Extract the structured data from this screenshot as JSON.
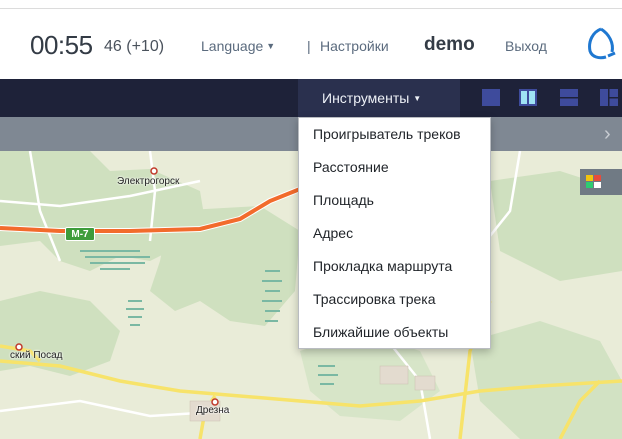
{
  "header": {
    "clock_main": "00:55",
    "clock_sub": "46 (+10)",
    "language_label": "Language",
    "separator": "|",
    "settings_label": "Настройки",
    "user_name": "demo",
    "logout_label": "Выход"
  },
  "navbar": {
    "tools_label": "Инструменты"
  },
  "tools_menu": {
    "items": [
      "Проигрыватель треков",
      "Расстояние",
      "Площадь",
      "Адрес",
      "Прокладка маршрута",
      "Трассировка трека",
      "Ближайшие объекты"
    ]
  },
  "map": {
    "labels": [
      "Электрогорск",
      "ский Посад",
      "Дрезна"
    ],
    "road_badge": "M-7"
  },
  "colors": {
    "navbar": "#1e2239",
    "subbar": "#7f8893",
    "layout_icon": "#3e4b9c",
    "highway": "#f26b2c",
    "road_badge": "#3e9c3b",
    "logo": "#1f78d1"
  },
  "icons": [
    "caret-down-icon",
    "brand-logo-icon",
    "layout-icons",
    "chevron-right-icon",
    "map-layers-icon"
  ]
}
